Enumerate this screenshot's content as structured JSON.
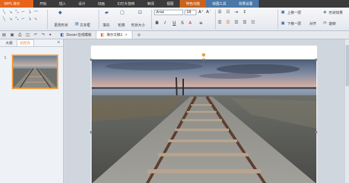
{
  "app": {
    "name": "WPS 演示"
  },
  "menu": [
    "开始",
    "插入",
    "设计",
    "动画",
    "幻灯片放映",
    "审阅",
    "视图",
    "特色功能",
    "绘图工具",
    "效果设置"
  ],
  "ribbon": {
    "change_shape": "更改形状",
    "textbox": "文本框",
    "fill": "填充",
    "outline": "轮廓",
    "shape_size": "形状大小",
    "font_name": "Arial",
    "font_size": "18",
    "bring_forward": "上移一层",
    "send_backward": "下移一层",
    "align": "对齐",
    "rotate": "旋转",
    "shape_effect": "形状效果"
  },
  "tabs": [
    {
      "label": "Docer-在线模板"
    },
    {
      "label": "演示文稿1"
    }
  ],
  "left_panel": {
    "tab_outline": "大纲",
    "tab_slides": "幻灯片",
    "slide_number": "1"
  },
  "colors": {
    "accent_orange": "#e8641b",
    "selection_orange": "#f0a040"
  }
}
